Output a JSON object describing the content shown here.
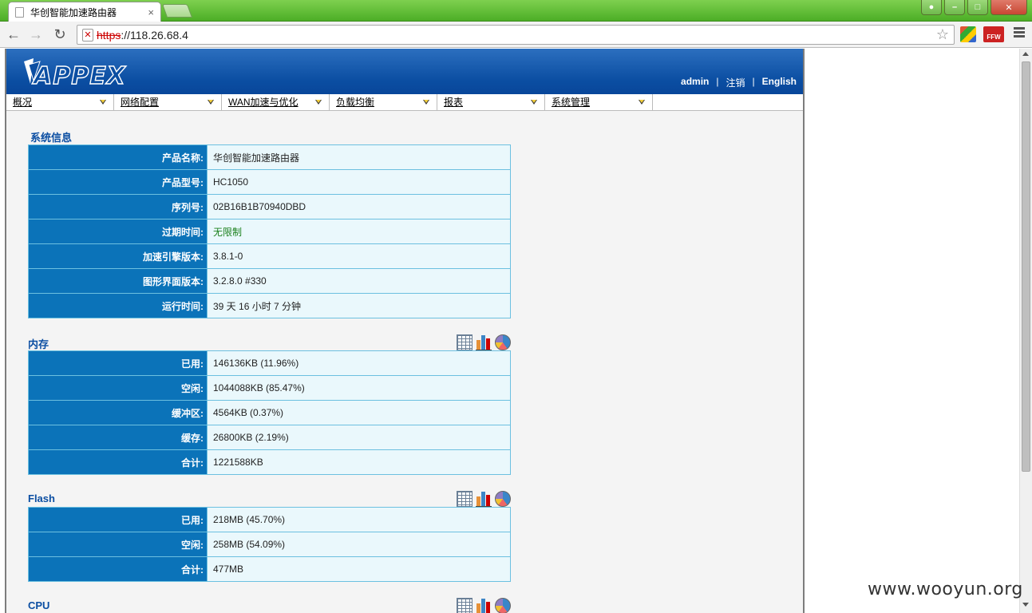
{
  "browser": {
    "tab_title": "华创智能加速路由器",
    "tab_close": "×",
    "url_scheme": "https",
    "url_rest": "://118.26.68.4",
    "ext_ffw_label": "FFW"
  },
  "header": {
    "logo_text": "APPEX",
    "user": "admin",
    "separator": "|",
    "logout": "注销",
    "language": "English"
  },
  "menu": [
    {
      "label": "概况"
    },
    {
      "label": "网络配置"
    },
    {
      "label": "WAN加速与优化"
    },
    {
      "label": "负载均衡"
    },
    {
      "label": "报表"
    },
    {
      "label": "系统管理"
    }
  ],
  "system_info": {
    "title": "系统信息",
    "rows": [
      {
        "key": "产品名称:",
        "value": "华创智能加速路由器"
      },
      {
        "key": "产品型号:",
        "value": "HC1050"
      },
      {
        "key": "序列号:",
        "value": "02B16B1B70940DBD"
      },
      {
        "key": "过期时间:",
        "value": "无限制"
      },
      {
        "key": "加速引擎版本:",
        "value": "3.8.1-0"
      },
      {
        "key": "图形界面版本:",
        "value": "3.2.8.0 #330"
      },
      {
        "key": "运行时间:",
        "value": "39 天 16 小时 7 分钟"
      }
    ]
  },
  "memory": {
    "title": "内存",
    "rows": [
      {
        "key": "已用:",
        "value": "146136KB (11.96%)"
      },
      {
        "key": "空闲:",
        "value": "1044088KB (85.47%)"
      },
      {
        "key": "缓冲区:",
        "value": "4564KB (0.37%)"
      },
      {
        "key": "缓存:",
        "value": "26800KB (2.19%)"
      },
      {
        "key": "合计:",
        "value": "1221588KB"
      }
    ]
  },
  "flash": {
    "title": "Flash",
    "rows": [
      {
        "key": "已用:",
        "value": "218MB (45.70%)"
      },
      {
        "key": "空闲:",
        "value": "258MB (54.09%)"
      },
      {
        "key": "合计:",
        "value": "477MB"
      }
    ]
  },
  "cpu": {
    "title": "CPU"
  },
  "watermark": "www.wooyun.org",
  "colors": {
    "banner": "#0b4ea2",
    "key_cell": "#0b73b9",
    "value_cell": "#eaf8fc",
    "green_value": "#1a7f1a"
  }
}
